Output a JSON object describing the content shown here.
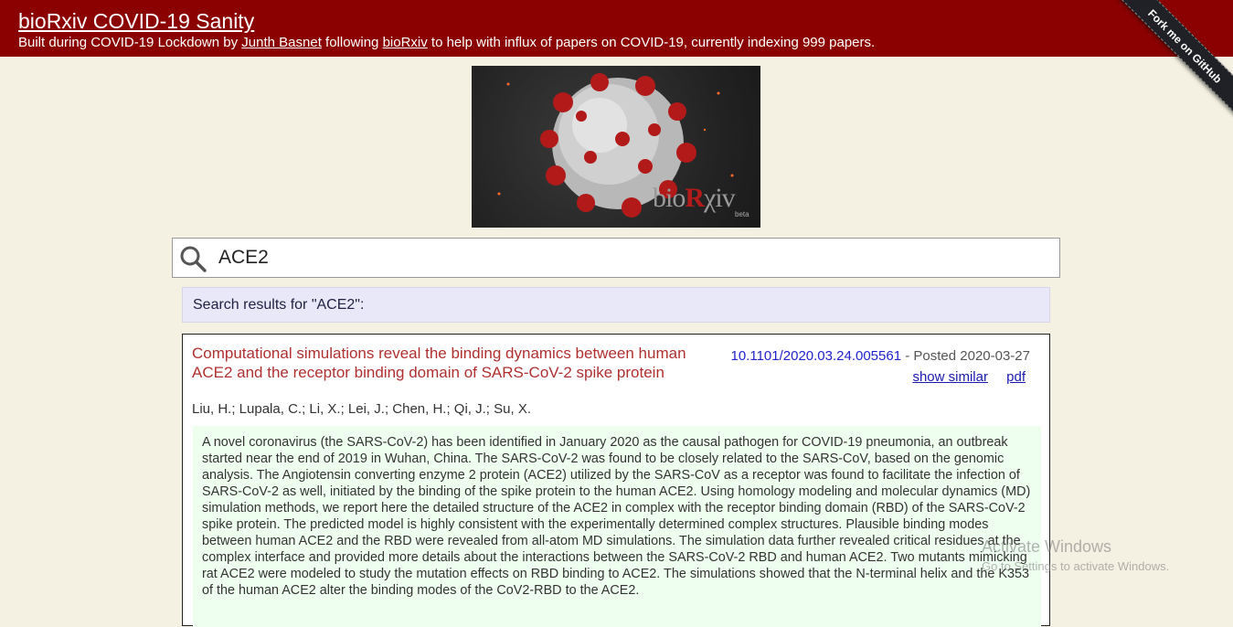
{
  "header": {
    "title": "bioRxiv COVID-19 Sanity",
    "subtitle_prefix": "Built during COVID-19 Lockdown by ",
    "author_link": "Junth Basnet",
    "subtitle_mid": " following ",
    "source_link": "bioRxiv",
    "subtitle_suffix": " to help with influx of papers on COVID-19, currently indexing 999 papers."
  },
  "ribbon": {
    "label": "Fork me on GitHub"
  },
  "hero": {
    "brand_prefix": "bio",
    "brand_r": "R",
    "brand_suffix": "χiv",
    "beta": "beta"
  },
  "search": {
    "value": "ACE2",
    "icon": "search-icon"
  },
  "results": {
    "heading": "Search results for \"ACE2\":"
  },
  "paper": {
    "title": "Computational simulations reveal the binding dynamics between human ACE2 and the receptor binding domain of SARS-CoV-2 spike protein",
    "authors": "Liu, H.; Lupala, C.; Li, X.; Lei, J.; Chen, H.; Qi, J.; Su, X.",
    "doi": "10.1101/2020.03.24.005561",
    "posted": " - Posted 2020-03-27",
    "show_similar": "show similar",
    "pdf": "pdf",
    "abstract": "A novel coronavirus (the SARS-CoV-2) has been identified in January 2020 as the causal pathogen for COVID-19 pneumonia, an outbreak started near the end of 2019 in Wuhan, China. The SARS-CoV-2 was found to be closely related to the SARS-CoV, based on the genomic analysis. The Angiotensin converting enzyme 2 protein (ACE2) utilized by the SARS-CoV as a receptor was found to facilitate the infection of SARS-CoV-2 as well, initiated by the binding of the spike protein to the human ACE2. Using homology modeling and molecular dynamics (MD) simulation methods, we report here the detailed structure of the ACE2 in complex with the receptor binding domain (RBD) of the SARS-CoV-2 spike protein. The predicted model is highly consistent with the experimentally determined complex structures. Plausible binding modes between human ACE2 and the RBD were revealed from all-atom MD simulations. The simulation data further revealed critical residues at the complex interface and provided more details about the interactions between the SARS-CoV-2 RBD and human ACE2. Two mutants mimicking rat ACE2 were modeled to study the mutation effects on RBD binding to ACE2. The simulations showed that the N-terminal helix and the K353 of the human ACE2 alter the binding modes of the CoV2-RBD to the ACE2."
  },
  "watermark": {
    "line1": "Activate Windows",
    "line2": "Go to Settings to activate Windows."
  },
  "colors": {
    "header_bg": "#8b0000",
    "page_bg": "#f4f0e2",
    "title_red": "#b03030",
    "abstract_bg": "#efffef",
    "results_bg": "#e9e8f8"
  }
}
